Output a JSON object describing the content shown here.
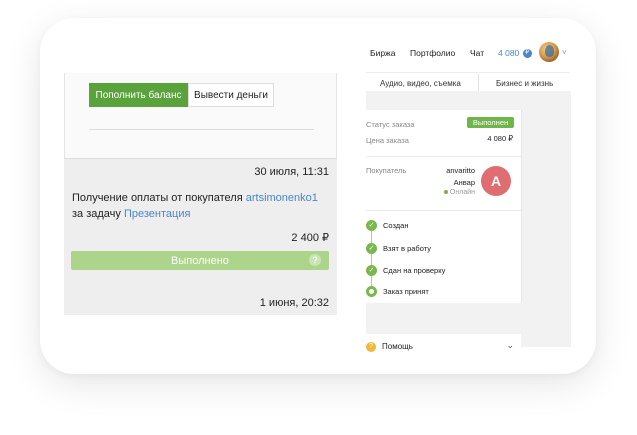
{
  "nav": {
    "exchange": "Биржа",
    "portfolio": "Портфолио",
    "chat": "Чат",
    "balance": "4 080",
    "currency_icon": "ruble-coin-icon",
    "chevron": "˅"
  },
  "sub_nav": {
    "left": "Аудио, видео, съемка",
    "right": "Бизнес и жизнь"
  },
  "balance_actions": {
    "topup_label": "Пополнить баланс",
    "withdraw_label": "Вывести деньги"
  },
  "transaction": {
    "date": "30 июля, 11:31",
    "desc_prefix": "Получение оплаты от покупателя ",
    "buyer_link": "artsimonenko1",
    "desc_mid": " за задачу ",
    "task_link": "Презентация",
    "amount": "2 400 ₽",
    "status": "Выполнено",
    "status_help": "?"
  },
  "next_transaction": {
    "date": "1 июня, 20:32"
  },
  "order": {
    "status_label": "Статус заказа",
    "status_value": "Выполнен",
    "price_label": "Цена заказа",
    "price_value": "4 080 ₽",
    "buyer_label": "Покупатель",
    "buyer_username": "anvaritto",
    "buyer_name": "Анвар",
    "buyer_online": "Онлайн",
    "buyer_initial": "A",
    "steps": [
      {
        "label": "Создан",
        "check": "✓"
      },
      {
        "label": "Взят в работу",
        "check": "✓"
      },
      {
        "label": "Сдан на проверку",
        "check": "✓"
      },
      {
        "label": "Заказ принят",
        "check": ""
      }
    ]
  },
  "help": {
    "icon_text": "?",
    "label": "Помощь",
    "chevron": "⌄"
  },
  "colors": {
    "green": "#5aa33c",
    "status_green": "#acd48b",
    "link": "#4a86c8",
    "avatar": "#df6d72"
  }
}
